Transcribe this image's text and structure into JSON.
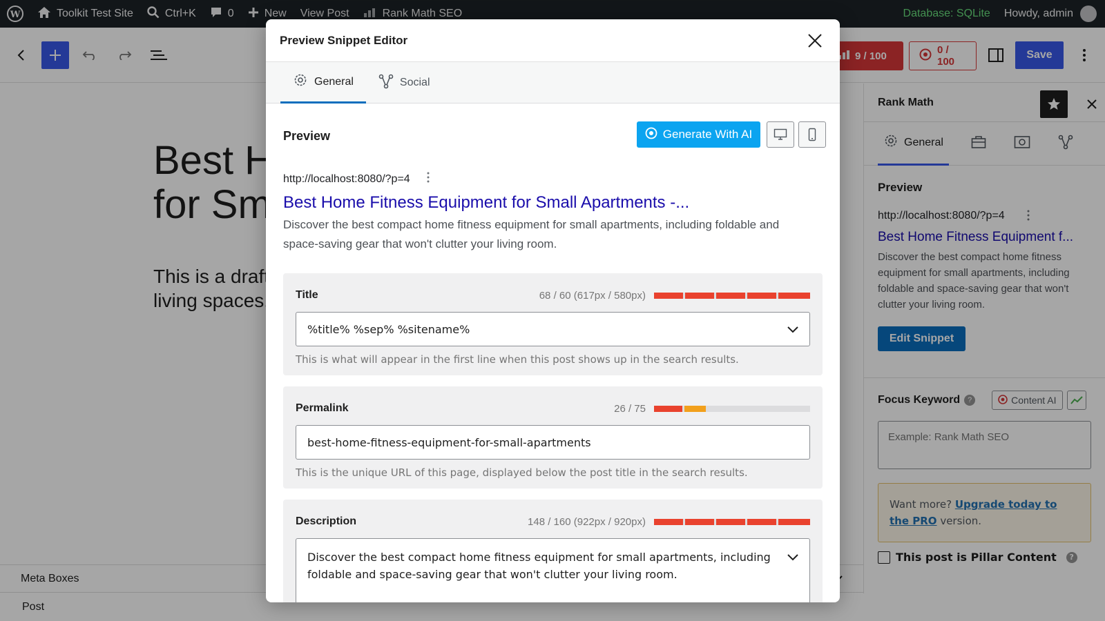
{
  "admin_bar": {
    "site_name": "Toolkit Test Site",
    "search_shortcut": "Ctrl+K",
    "comments_count": "0",
    "new_label": "New",
    "view_post": "View Post",
    "rank_math": "Rank Math SEO",
    "database": "Database: SQLite",
    "howdy": "Howdy, admin"
  },
  "toolbar": {
    "score_seo": "9 / 100",
    "score_ca": "0 / 100",
    "save_label": "Save"
  },
  "canvas": {
    "title_visible": "Best H\nfor Sm",
    "para_visible": "This is a draft t\nliving spaces. I"
  },
  "bottom": {
    "meta_boxes": "Meta Boxes",
    "breadcrumb": "Post"
  },
  "sidebar": {
    "title": "Rank Math",
    "tab_general": "General",
    "preview_label": "Preview",
    "url": "http://localhost:8080/?p=4",
    "link": "Best Home Fitness Equipment f...",
    "desc": "Discover the best compact home fitness equipment for small apartments, including foldable and space-saving gear that won't clutter your living room.",
    "edit_snippet": "Edit Snippet",
    "focus_keyword": "Focus Keyword",
    "content_ai": "Content AI",
    "fk_placeholder": "Example: Rank Math SEO",
    "upgrade_pre": "Want more? ",
    "upgrade_link": "Upgrade today to the PRO",
    "upgrade_post": " version.",
    "pillar": "This post is Pillar Content"
  },
  "modal": {
    "title": "Preview Snippet Editor",
    "tab_general": "General",
    "tab_social": "Social",
    "preview_label": "Preview",
    "gen_ai": "Generate With AI",
    "serp_url": "http://localhost:8080/?p=4",
    "serp_title": "Best Home Fitness Equipment for Small Apartments -...",
    "serp_desc": "Discover the best compact home fitness equipment for small apartments, including foldable and space-saving gear that won't clutter your living room.",
    "fields": {
      "title": {
        "label": "Title",
        "counter": "68 / 60 (617px / 580px)",
        "value": "%title% %sep% %sitename%",
        "help": "This is what will appear in the first line when this post shows up in the search results.",
        "bar_color": "#e9422e",
        "bar_filled_segments": 5
      },
      "permalink": {
        "label": "Permalink",
        "counter": "26 / 75",
        "value": "best-home-fitness-equipment-for-small-apartments",
        "help": "This is the unique URL of this page, displayed below the post title in the search results.",
        "bar_colors": [
          "#e9422e",
          "#f2a01c"
        ],
        "bar_filled_segments": 2
      },
      "description": {
        "label": "Description",
        "counter": "148 / 160 (922px / 920px)",
        "value": "Discover the best compact home fitness equipment for small apartments, including foldable and space-saving gear that won't clutter your living room.",
        "bar_color": "#e9422e",
        "bar_filled_segments": 5
      }
    }
  }
}
